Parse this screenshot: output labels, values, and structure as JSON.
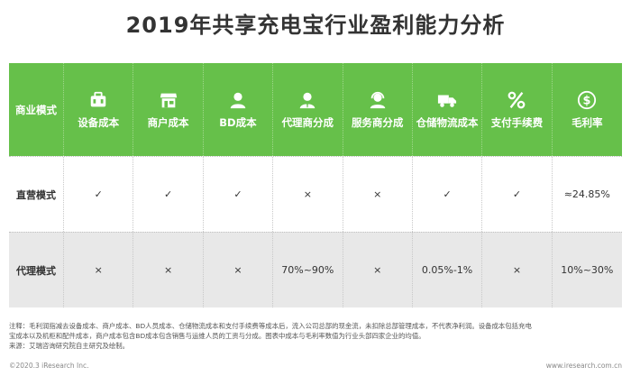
{
  "title": "2019年共享充电宝行业盈利能力分析",
  "table": {
    "corner_label": "商业模式",
    "columns": [
      {
        "label": "设备成本",
        "icon": "device-icon"
      },
      {
        "label": "商户成本",
        "icon": "store-icon"
      },
      {
        "label": "BD成本",
        "icon": "person-icon"
      },
      {
        "label": "代理商分成",
        "icon": "agent-icon"
      },
      {
        "label": "服务商分成",
        "icon": "service-icon"
      },
      {
        "label": "仓储物流成本",
        "icon": "truck-icon"
      },
      {
        "label": "支付手续费",
        "icon": "percent-icon"
      },
      {
        "label": "毛利率",
        "icon": "money-icon"
      }
    ],
    "rows": [
      {
        "label": "直营模式",
        "cells": [
          "✓",
          "✓",
          "✓",
          "×",
          "×",
          "✓",
          "✓",
          "≈24.85%"
        ]
      },
      {
        "label": "代理模式",
        "cells": [
          "×",
          "×",
          "×",
          "70%~90%",
          "×",
          "0.05%-1%",
          "×",
          "10%~30%"
        ]
      }
    ]
  },
  "note_line1": "注释：毛利润指减去设备成本、商户成本、BD人员成本、仓储物流成本和支付手续费等成本后，流入公司总部的现金流，未扣除总部管理成本，不代表净利润。设备成本包括充电",
  "note_line2": "宝成本以及机柜和配件成本，商户成本包含BD成本包含销售与运维人员的工资与分成。图表中成本与毛利率数值为行业头部四家企业的均值。",
  "source": "来源：艾瑞咨询研究院自主研究及绘制。",
  "footer_left": "©2020.3 iResearch Inc.",
  "footer_right": "www.iresearch.com.cn",
  "colors": {
    "header_green": "#66c04a",
    "row_alt": "#e8e8e8"
  }
}
